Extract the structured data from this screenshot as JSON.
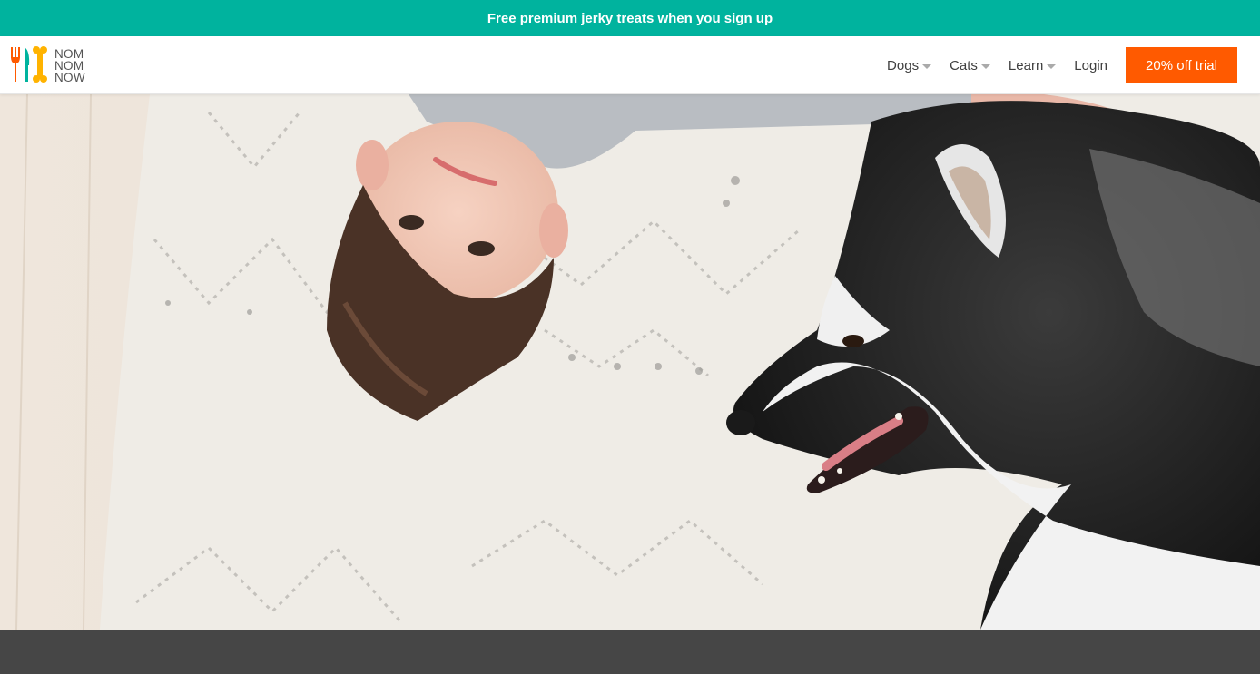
{
  "promo_banner": {
    "text": "Free premium jerky treats when you sign up"
  },
  "brand": {
    "name_lines": [
      "NOM",
      "NOM",
      "NOW"
    ],
    "logo_colors": {
      "fork": "#ff5a00",
      "knife": "#00b39e",
      "bone": "#ffb300"
    }
  },
  "nav": {
    "items": [
      {
        "label": "Dogs",
        "has_dropdown": true
      },
      {
        "label": "Cats",
        "has_dropdown": true
      },
      {
        "label": "Learn",
        "has_dropdown": true
      }
    ],
    "login_label": "Login",
    "cta_label": "20% off trial"
  },
  "colors": {
    "teal": "#00b39e",
    "orange": "#ff5a00",
    "dark_band": "#464646"
  },
  "hero": {
    "image": "boy-and-husky-on-rug"
  }
}
